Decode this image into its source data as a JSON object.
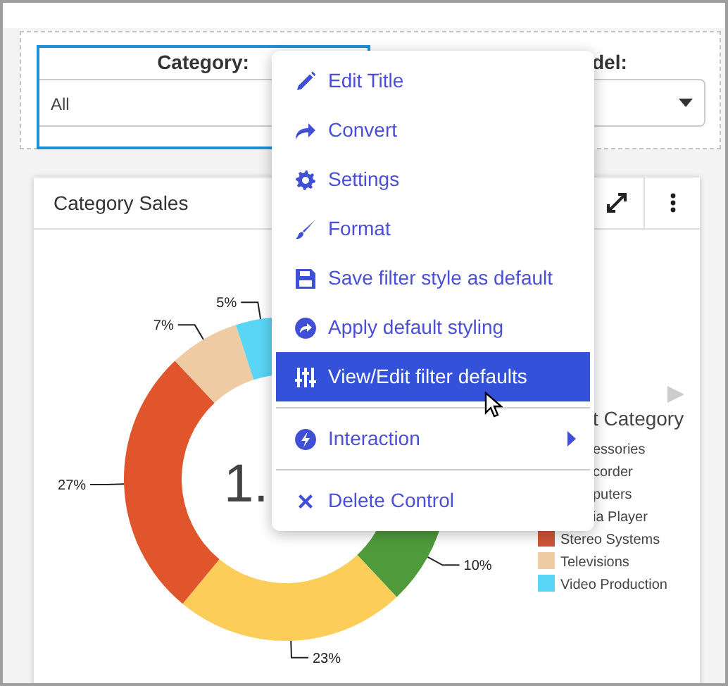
{
  "filters": [
    {
      "label": "Category:",
      "value": "All",
      "active": true
    },
    {
      "label": "del:",
      "active": false
    }
  ],
  "card": {
    "title": "Category Sales",
    "center_text": "1.",
    "chart_data": {
      "type": "donut",
      "values": [
        10,
        23,
        27,
        7,
        5
      ],
      "value_labels": [
        "10%",
        "23%",
        "27%",
        "7%",
        "5%"
      ],
      "colors": [
        "#4f9b3c",
        "#fccd58",
        "#e0552c",
        "#efcba3",
        "#5ad5f6"
      ]
    },
    "legend": {
      "title": "t Category",
      "items": [
        {
          "label": "essories",
          "kind": "clipped"
        },
        {
          "label": "corder",
          "kind": "clipped"
        },
        {
          "label": "puters",
          "kind": "clipped"
        },
        {
          "label": "ia Player",
          "kind": "clipped"
        },
        {
          "label": "Stereo Systems",
          "kind": "swatch",
          "color": "#cf5536"
        },
        {
          "label": "Televisions",
          "kind": "swatch",
          "color": "#efcba3"
        },
        {
          "label": "Video Production",
          "kind": "swatch",
          "color": "#5ad5f6"
        }
      ]
    }
  },
  "menu": {
    "items": [
      {
        "label": "Edit Title",
        "selected": false,
        "divider_before": false,
        "has_submenu": false
      },
      {
        "label": "Convert",
        "selected": false,
        "divider_before": false,
        "has_submenu": false
      },
      {
        "label": "Settings",
        "selected": false,
        "divider_before": false,
        "has_submenu": false
      },
      {
        "label": "Format",
        "selected": false,
        "divider_before": false,
        "has_submenu": false
      },
      {
        "label": "Save filter style as default",
        "selected": false,
        "divider_before": false,
        "has_submenu": false
      },
      {
        "label": "Apply default styling",
        "selected": false,
        "divider_before": false,
        "has_submenu": false
      },
      {
        "label": "View/Edit filter defaults",
        "selected": true,
        "divider_before": false,
        "has_submenu": false
      },
      {
        "label": "Interaction",
        "selected": false,
        "divider_before": true,
        "has_submenu": true
      },
      {
        "label": "Delete Control",
        "selected": false,
        "divider_before": true,
        "has_submenu": false
      }
    ]
  }
}
